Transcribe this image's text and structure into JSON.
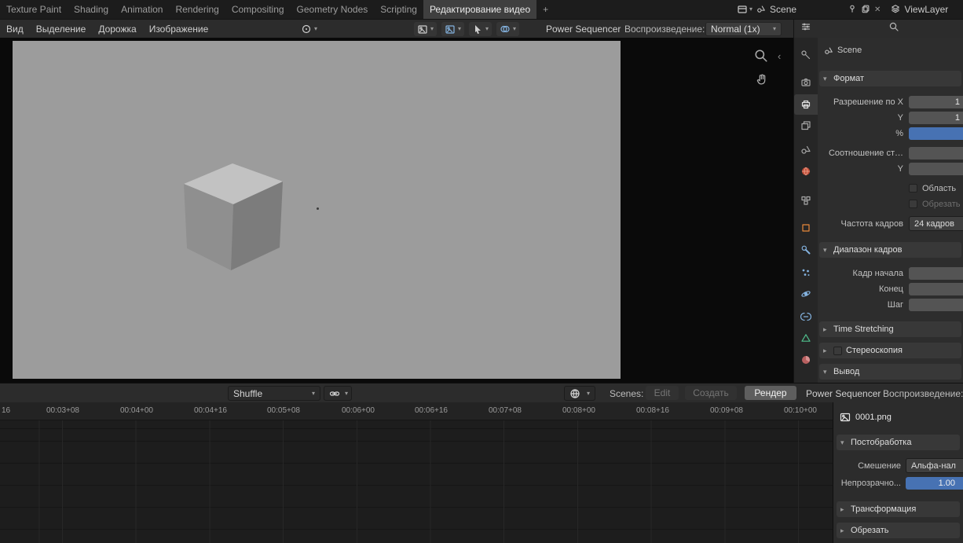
{
  "icons": {
    "plus": "+",
    "close": "✕",
    "caret": "▾",
    "chevron_down": "▾",
    "chevron_right": "▸",
    "collapse_left": "‹"
  },
  "topbar": {
    "tabs": [
      "Texture Paint",
      "Shading",
      "Animation",
      "Rendering",
      "Compositing",
      "Geometry Nodes",
      "Scripting",
      "Редактирование видео"
    ],
    "scene_label": "Scene",
    "view_layer_label": "ViewLayer"
  },
  "preview": {
    "menus": [
      "Вид",
      "Выделение",
      "Дорожка",
      "Изображение"
    ],
    "power_sequencer_label": "Power Sequencer",
    "playback_label": "Воспроизведение:",
    "playback_value": "Normal (1x)"
  },
  "properties": {
    "breadcrumb": "Scene",
    "format": {
      "title": "Формат",
      "res_x_label": "Разрешение по X",
      "res_x_value": "1",
      "res_y_label": "Y",
      "res_y_value": "1",
      "percent_label": "%",
      "aspect_x_label": "Соотношение ст…",
      "aspect_y_label": "Y",
      "region_label": "Область",
      "crop_label": "Обрезать",
      "fps_label": "Частота кадров",
      "fps_value": "24 кадров"
    },
    "frame_range": {
      "title": "Диапазон кадров",
      "start_label": "Кадр начала",
      "end_label": "Конец",
      "step_label": "Шаг"
    },
    "time_stretching_title": "Time Stretching",
    "stereoscopy_title": "Стереоскопия",
    "output_title": "Вывод"
  },
  "sequencer": {
    "shuffle_label": "Shuffle",
    "scenes_label": "Scenes:",
    "edit_label": "Edit",
    "create_label": "Создать",
    "render_label": "Рендер",
    "power_sequencer_label": "Power Sequencer",
    "playback_label": "Воспроизведение:",
    "ruler_labels": [
      "16",
      "00:03+08",
      "00:04+00",
      "00:04+16",
      "00:05+08",
      "00:06+00",
      "00:06+16",
      "00:07+08",
      "00:08+00",
      "00:08+16",
      "00:09+08",
      "00:10+00"
    ]
  },
  "strip": {
    "name": "0001.png",
    "post_title": "Постобработка",
    "blend_label": "Смешение",
    "blend_value": "Альфа-нал",
    "opacity_label": "Непрозрачно...",
    "opacity_value": "1.00",
    "transform_title": "Трансформация",
    "crop_title": "Обрезать"
  },
  "colors": {
    "accent": "#4772b3",
    "object_orange": "#e8883a",
    "modifier_blue": "#84b3e0",
    "data_green": "#4fbd8b",
    "world_red": "#c5503a",
    "material_pink": "#b75f5f"
  }
}
